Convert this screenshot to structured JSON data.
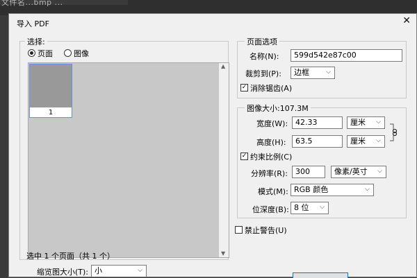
{
  "background": {
    "title": "文件名...bmp ..."
  },
  "dialog": {
    "title": "导入 PDF",
    "close_glyph": "✕",
    "select": {
      "legend": "选择:",
      "radio_page": "页面",
      "radio_image": "图像",
      "thumbnail_number": "1",
      "status": "选中 1 个页面（共 1 个）",
      "thumb_size_label": "缩览图大小(T):",
      "thumb_size_value": "小"
    },
    "page_options": {
      "legend": "页面选项",
      "name_label": "名称(N):",
      "name_value": "599d542e87c00",
      "crop_label": "裁剪到(P):",
      "crop_value": "边框",
      "antialias_label": "消除锯齿(A)",
      "antialias_checked": true
    },
    "image_size": {
      "legend": "图像大小:107.3M",
      "width_label": "宽度(W):",
      "width_value": "42.33",
      "width_unit": "厘米",
      "height_label": "高度(H):",
      "height_value": "63.5",
      "height_unit": "厘米",
      "constrain_label": "约束比例(C)",
      "constrain_checked": true,
      "resolution_label": "分辨率(R):",
      "resolution_value": "300",
      "resolution_unit": "像素/英寸",
      "mode_label": "模式(M):",
      "mode_value": "RGB 颜色",
      "depth_label": "位深度(B):",
      "depth_value": "8 位"
    },
    "suppress_warnings_label": "禁止警告(U)",
    "suppress_warnings_checked": false
  },
  "colors": {
    "accent": "#0078d7",
    "dialog_bg": "#f0f0f0",
    "app_bg": "#3a3a3a"
  },
  "icons": [
    "close-icon",
    "link-chain-icon",
    "chevron-down-icon",
    "scroll-arrow-icon"
  ]
}
